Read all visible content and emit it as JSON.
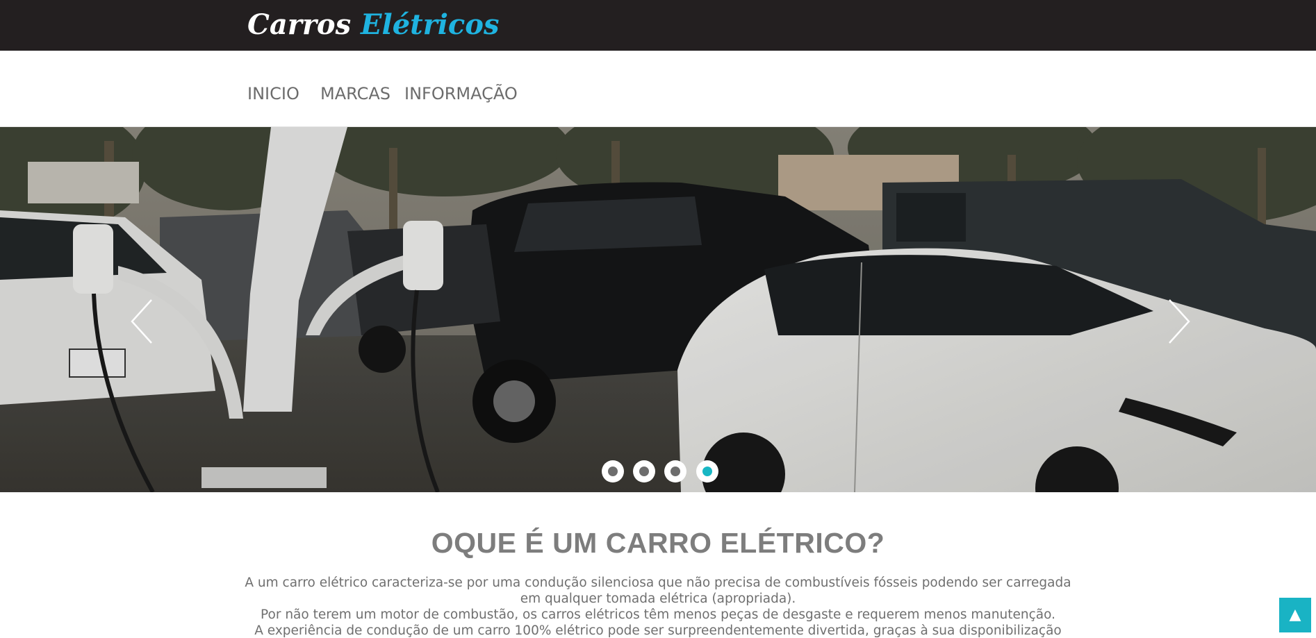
{
  "header": {
    "logo_part1": "Carros",
    "logo_part2": "Elétricos"
  },
  "nav": {
    "items": [
      "INICIO",
      "MARCAS",
      "INFORMAÇÃO"
    ]
  },
  "carousel": {
    "slide_count": 4,
    "active_index": 3
  },
  "main": {
    "heading": "OQUE É UM CARRO ELÉTRICO?",
    "lines": [
      "A um carro elétrico caracteriza-se por uma condução silenciosa que não precisa de combustíveis fósseis podendo ser carregada",
      "em qualquer tomada elétrica (apropriada).",
      "Por não terem um motor de combustão, os carros elétricos têm menos peças de desgaste e requerem menos manutenção.",
      "A experiência de condução de um carro 100% elétrico pode ser surpreendentemente divertida, graças à sua disponibilização"
    ]
  },
  "back_to_top": {
    "icon": "up-triangle-icon",
    "glyph": "▲"
  },
  "colors": {
    "topbar": "#231f20",
    "logo_accent": "#1fb3e0",
    "nav_text": "#6c6c6c",
    "indicator_active": "#18b7c4",
    "back_to_top": "#19b3c4"
  }
}
